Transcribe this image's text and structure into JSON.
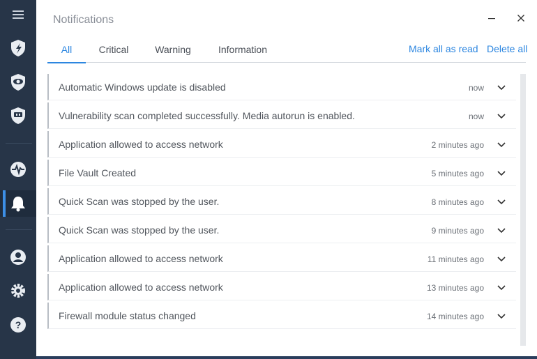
{
  "window": {
    "title": "Notifications"
  },
  "tabs": [
    {
      "label": "All",
      "active": true
    },
    {
      "label": "Critical",
      "active": false
    },
    {
      "label": "Warning",
      "active": false
    },
    {
      "label": "Information",
      "active": false
    }
  ],
  "actions": {
    "mark_all_read": "Mark all as read",
    "delete_all": "Delete all"
  },
  "sidebar": {
    "items": [
      {
        "icon": "menu-icon"
      },
      {
        "icon": "shield-icon"
      },
      {
        "icon": "privacy-shield-icon"
      },
      {
        "icon": "webcam-shield-icon"
      },
      {
        "icon": "activity-icon"
      },
      {
        "icon": "bell-icon",
        "active": true
      },
      {
        "icon": "user-icon"
      },
      {
        "icon": "settings-icon"
      },
      {
        "icon": "help-icon"
      }
    ]
  },
  "notifications": [
    {
      "text": "Automatic Windows update is disabled",
      "time": "now"
    },
    {
      "text": "Vulnerability scan completed successfully. Media autorun is enabled.",
      "time": "now"
    },
    {
      "text": "Application allowed to access network",
      "time": "2 minutes ago"
    },
    {
      "text": "File Vault Created",
      "time": "5 minutes ago"
    },
    {
      "text": "Quick Scan was stopped by the user.",
      "time": "8 minutes ago"
    },
    {
      "text": "Quick Scan was stopped by the user.",
      "time": "9 minutes ago"
    },
    {
      "text": "Application allowed to access network",
      "time": "11 minutes ago"
    },
    {
      "text": "Application allowed to access network",
      "time": "13 minutes ago"
    },
    {
      "text": "Firewall module status changed",
      "time": "14 minutes ago"
    }
  ],
  "colors": {
    "accent": "#2c86e0",
    "sidebar": "#273548",
    "active_indicator": "#3d8fe6"
  }
}
